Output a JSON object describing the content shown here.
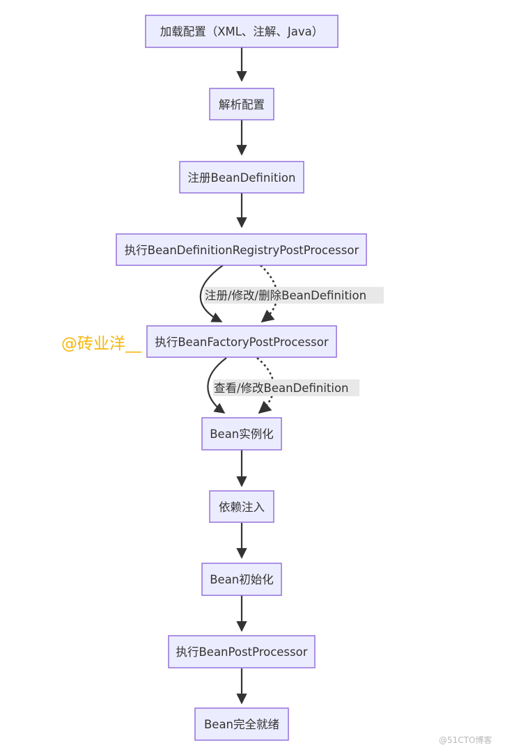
{
  "diagram": {
    "type": "flowchart",
    "direction": "top-down",
    "colors": {
      "node_fill": "#ECECFF",
      "node_stroke": "#9370DB",
      "edge": "#333333",
      "edge_label_bg": "#e8e8e8",
      "author_watermark": "#F5B80B",
      "site_watermark": "#b8b8b8"
    },
    "nodes": [
      {
        "id": "load",
        "label": "加载配置（XML、注解、Java）"
      },
      {
        "id": "parse",
        "label": "解析配置"
      },
      {
        "id": "register",
        "label": "注册BeanDefinition"
      },
      {
        "id": "bdrpp",
        "label": "执行BeanDefinitionRegistryPostProcessor"
      },
      {
        "id": "bfpp",
        "label": "执行BeanFactoryPostProcessor"
      },
      {
        "id": "instantiate",
        "label": "Bean实例化"
      },
      {
        "id": "inject",
        "label": "依赖注入"
      },
      {
        "id": "init",
        "label": "Bean初始化"
      },
      {
        "id": "bpp",
        "label": "执行BeanPostProcessor"
      },
      {
        "id": "ready",
        "label": "Bean完全就绪"
      }
    ],
    "edges": [
      {
        "from": "load",
        "to": "parse",
        "style": "solid",
        "label": ""
      },
      {
        "from": "parse",
        "to": "register",
        "style": "solid",
        "label": ""
      },
      {
        "from": "register",
        "to": "bdrpp",
        "style": "solid",
        "label": ""
      },
      {
        "from": "bdrpp",
        "to": "bfpp",
        "style": "solid",
        "label": ""
      },
      {
        "from": "bdrpp",
        "to": "bfpp",
        "style": "dotted",
        "label": "注册/修改/删除BeanDefinition"
      },
      {
        "from": "bfpp",
        "to": "instantiate",
        "style": "solid",
        "label": ""
      },
      {
        "from": "bfpp",
        "to": "instantiate",
        "style": "dotted",
        "label": "查看/修改BeanDefinition"
      },
      {
        "from": "instantiate",
        "to": "inject",
        "style": "solid",
        "label": ""
      },
      {
        "from": "inject",
        "to": "init",
        "style": "solid",
        "label": ""
      },
      {
        "from": "init",
        "to": "bpp",
        "style": "solid",
        "label": ""
      },
      {
        "from": "bpp",
        "to": "ready",
        "style": "solid",
        "label": ""
      }
    ]
  },
  "watermarks": {
    "author": "@砖业洋__",
    "site": "@51CTO博客"
  }
}
